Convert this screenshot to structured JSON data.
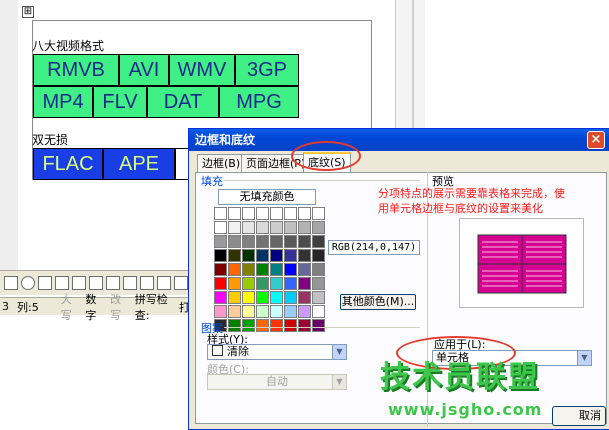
{
  "document": {
    "move_handle": "⊞",
    "section1_label": "八大视频格式",
    "formats_row1": [
      "RMVB",
      "AVI",
      "WMV",
      "3GP"
    ],
    "formats_row2": [
      "MP4",
      "FLV",
      "DAT",
      "MPG"
    ],
    "section2_label": "双无损",
    "formats_row3": [
      "FLAC",
      "APE"
    ]
  },
  "statusbar": {
    "line": "3",
    "col": "列:5",
    "caps": "大写",
    "num": "数字",
    "ovr": "改写",
    "spell": "拼写检查:",
    "more": "打"
  },
  "dialog": {
    "title": "边框和底纹",
    "close": "×",
    "tabs": [
      "边框(B)",
      "页面边框(P)",
      "底纹(S)"
    ],
    "active_tab": "底纹(S)",
    "fill_group": "填充",
    "no_fill": "无填充颜色",
    "rgb": "RGB(214,0,147)",
    "more_colors": "其他颜色(M)...",
    "pattern_group": "图案",
    "style_label": "样式(Y):",
    "style_value": "清除",
    "color_label": "颜色(C):",
    "color_value": "自动",
    "preview_label": "预览",
    "apply_label": "应用于(L):",
    "apply_value": "单元格",
    "cancel": "取消",
    "annotation": "分项特点的展示需要靠表格来完成，使用单元格边框与底纹的设置来美化",
    "palette": [
      "#ffffff",
      "#ffffff",
      "#ffffff",
      "#ffffff",
      "#ffffff",
      "#ffffff",
      "#ffffff",
      "#ffffff",
      "#ffffff",
      "#f2f2f2",
      "#e6e6e6",
      "#d9d9d9",
      "#cccccc",
      "#bfbfbf",
      "#b3b3b3",
      "#a6a6a6",
      "#999999",
      "#8c8c8c",
      "#808080",
      "#737373",
      "#666666",
      "#595959",
      "#4d4d4d",
      "#404040",
      "#000000",
      "#333300",
      "#003300",
      "#003366",
      "#000080",
      "#333399",
      "#333333",
      "#262626",
      "#800000",
      "#ff6600",
      "#808000",
      "#008000",
      "#008080",
      "#0000ff",
      "#666699",
      "#808080",
      "#ff0000",
      "#ff9900",
      "#99cc00",
      "#339966",
      "#33cccc",
      "#3366ff",
      "#800080",
      "#969696",
      "#ff00ff",
      "#ffcc00",
      "#ffff00",
      "#00ff00",
      "#00ffff",
      "#00ccff",
      "#993366",
      "#c0c0c0",
      "#ff99cc",
      "#ffcc99",
      "#ffff99",
      "#ccffcc",
      "#ccffff",
      "#99ccff",
      "#cc99ff",
      "#ffffff",
      "#2a2a2a",
      "#008000",
      "#00a000",
      "#ff6600",
      "#ff3300",
      "#cc0000",
      "#990033",
      "#660066"
    ],
    "preview_color": "#d60093"
  },
  "watermark": {
    "text": "技术员联盟",
    "url": "www.jsgho.com"
  }
}
